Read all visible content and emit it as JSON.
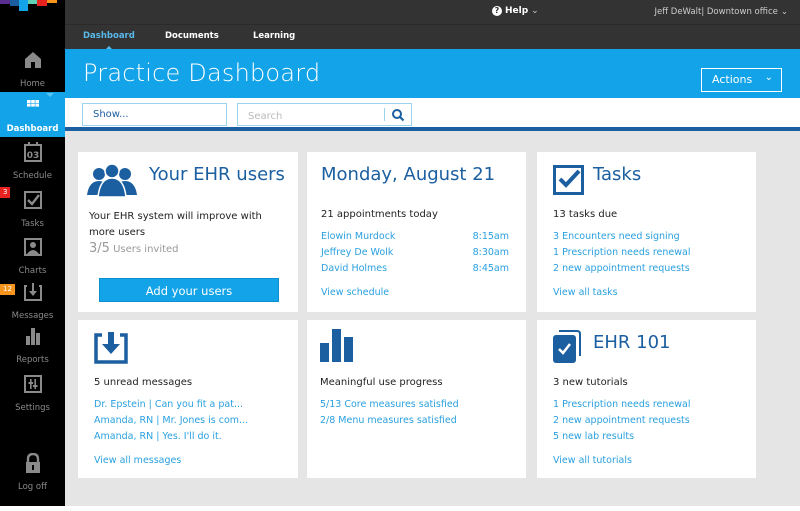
{
  "brand": {
    "logo_colors": [
      "#5a2d91",
      "#1c5fa0",
      "#12a3e8",
      "#5fd0b4",
      "#e8231f",
      "#f7941d"
    ]
  },
  "topbar": {
    "help_label": "Help",
    "help_icon": "question-circle-icon",
    "user_label": "Jeff DeWalt| Downtown office",
    "chevron": "⌵"
  },
  "tabs": [
    {
      "label": "Dashboard",
      "active": true
    },
    {
      "label": "Documents",
      "active": false
    },
    {
      "label": "Learning",
      "active": false
    }
  ],
  "sidebar": {
    "items": [
      {
        "label": "Home",
        "icon": "home-icon"
      },
      {
        "label": "Dashboard",
        "icon": "grid-icon",
        "active": true
      },
      {
        "label": "Schedule",
        "icon": "calendar-icon",
        "icon_text": "03"
      },
      {
        "label": "Tasks",
        "icon": "checkbox-icon",
        "badge": "3",
        "badge_color": "#e8231f"
      },
      {
        "label": "Charts",
        "icon": "person-icon"
      },
      {
        "label": "Messages",
        "icon": "inbox-icon",
        "badge": "12",
        "badge_color": "#f7941d"
      },
      {
        "label": "Reports",
        "icon": "bar-chart-icon"
      },
      {
        "label": "Settings",
        "icon": "sliders-icon"
      },
      {
        "label": "Log off",
        "icon": "lock-icon"
      }
    ]
  },
  "header": {
    "title": "Practice Dashboard",
    "actions_label": "Actions"
  },
  "filters": {
    "show_label": "Show...",
    "search_placeholder": "Search",
    "search_value": ""
  },
  "cards": {
    "users": {
      "title": "Your EHR users",
      "text": "Your EHR system will improve with more users",
      "count": "3/5",
      "count_label": "Users invited",
      "button": "Add your users"
    },
    "schedule": {
      "title": "Monday, August 21",
      "subtitle": "21 appointments today",
      "appointments": [
        {
          "name": "Elowin Murdock",
          "time": "8:15am"
        },
        {
          "name": "Jeffrey De Wolk",
          "time": "8:30am"
        },
        {
          "name": "David Holmes",
          "time": "8:45am"
        }
      ],
      "link": "View schedule"
    },
    "tasks": {
      "title": "Tasks",
      "subtitle": "13 tasks due",
      "items": [
        "3 Encounters need signing",
        "1 Prescription needs renewal",
        "2 new appointment requests"
      ],
      "link": "View all tasks"
    },
    "messages": {
      "subtitle": "5 unread messages",
      "items": [
        "Dr. Epstein | Can you fit a pat...",
        "Amanda, RN | Mr. Jones is com...",
        "Amanda, RN | Yes. I'll do it."
      ],
      "link": "View all messages"
    },
    "meaningful_use": {
      "subtitle": "Meaningful use progress",
      "items": [
        "5/13 Core measures satisfied",
        "2/8 Menu measures satisfied"
      ]
    },
    "ehr101": {
      "title": "EHR 101",
      "subtitle": "3 new tutorials",
      "items": [
        "1 Prescription needs renewal",
        "2 new appointment requests",
        "5 new lab results"
      ],
      "link": "View all tutorials"
    }
  },
  "colors": {
    "accent": "#12a3e8",
    "brand_dark": "#1c5fa0",
    "link": "#2aa0df",
    "topbar": "#333333",
    "sidebar": "#000000",
    "background": "#e5e5e5"
  }
}
